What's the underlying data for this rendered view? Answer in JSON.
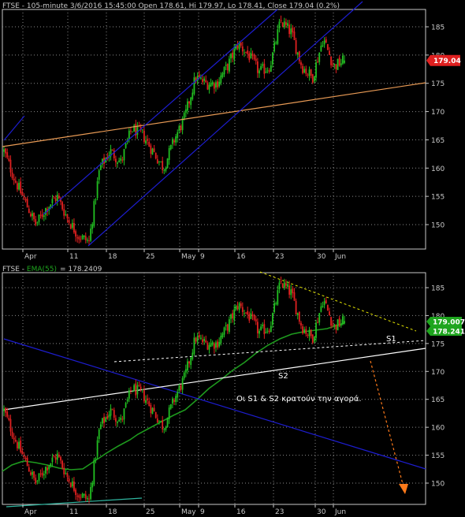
{
  "colors": {
    "background": "#000000",
    "grid": "#8a8a8a",
    "frame": "#c8c8c8",
    "axis_text": "#c8c8c8",
    "up_candle": "#22c022",
    "down_candle": "#e02020",
    "channel": "#1d1dcf",
    "orange_trend": "#e89a55",
    "ema_line": "#1e9a1e",
    "white_line": "#ffffff",
    "resistance": "#e6e600",
    "arrow": "#ff7a1a",
    "price_box_red": "#e02020",
    "price_box_green": "#1ea51e"
  },
  "chart_data": [
    {
      "type": "candlestick",
      "header": "FTSE - 105-minute 3/6/2016 15:45:00 Open 178.61, Hi 179.97, Lo 178.41, Close 179.04   (0.2%)",
      "ohlc": {
        "open": 178.61,
        "high": 179.97,
        "low": 178.41,
        "close": 179.04,
        "change": "(0.2%)"
      },
      "last_price_label": "179.04",
      "yticks": [
        150,
        155,
        160,
        165,
        170,
        175,
        180,
        185
      ],
      "ylim": [
        145.5,
        188.5
      ],
      "xticks": [
        "Apr",
        "11",
        "18",
        "25",
        "May",
        "9",
        "16",
        "23",
        "30",
        "Jun"
      ],
      "close_path": [
        163,
        158,
        154,
        150,
        153,
        155,
        151,
        148,
        147,
        160,
        163,
        161,
        167,
        166,
        163,
        160,
        165,
        169,
        176,
        175,
        175,
        178,
        182,
        180,
        177,
        178,
        186,
        184,
        178,
        176,
        183,
        178,
        179.04
      ],
      "overlays": [
        "blue rising channel",
        "orange trend line"
      ]
    },
    {
      "type": "candlestick",
      "header_prefix": "FTSE - ",
      "ema_label": "EMA(55)",
      "ema_value": "= 178.2409",
      "price_labels": [
        "179.007",
        "178.241"
      ],
      "yticks": [
        150,
        155,
        160,
        165,
        170,
        175,
        180,
        185
      ],
      "ylim": [
        145.5,
        188.5
      ],
      "xticks": [
        "Apr",
        "11",
        "18",
        "25",
        "May",
        "9",
        "16",
        "23",
        "30",
        "Jun"
      ],
      "annotations": [
        "S1",
        "S2",
        "Οι  S1  &  S2  κρατούν  την  αγορά."
      ]
    }
  ]
}
